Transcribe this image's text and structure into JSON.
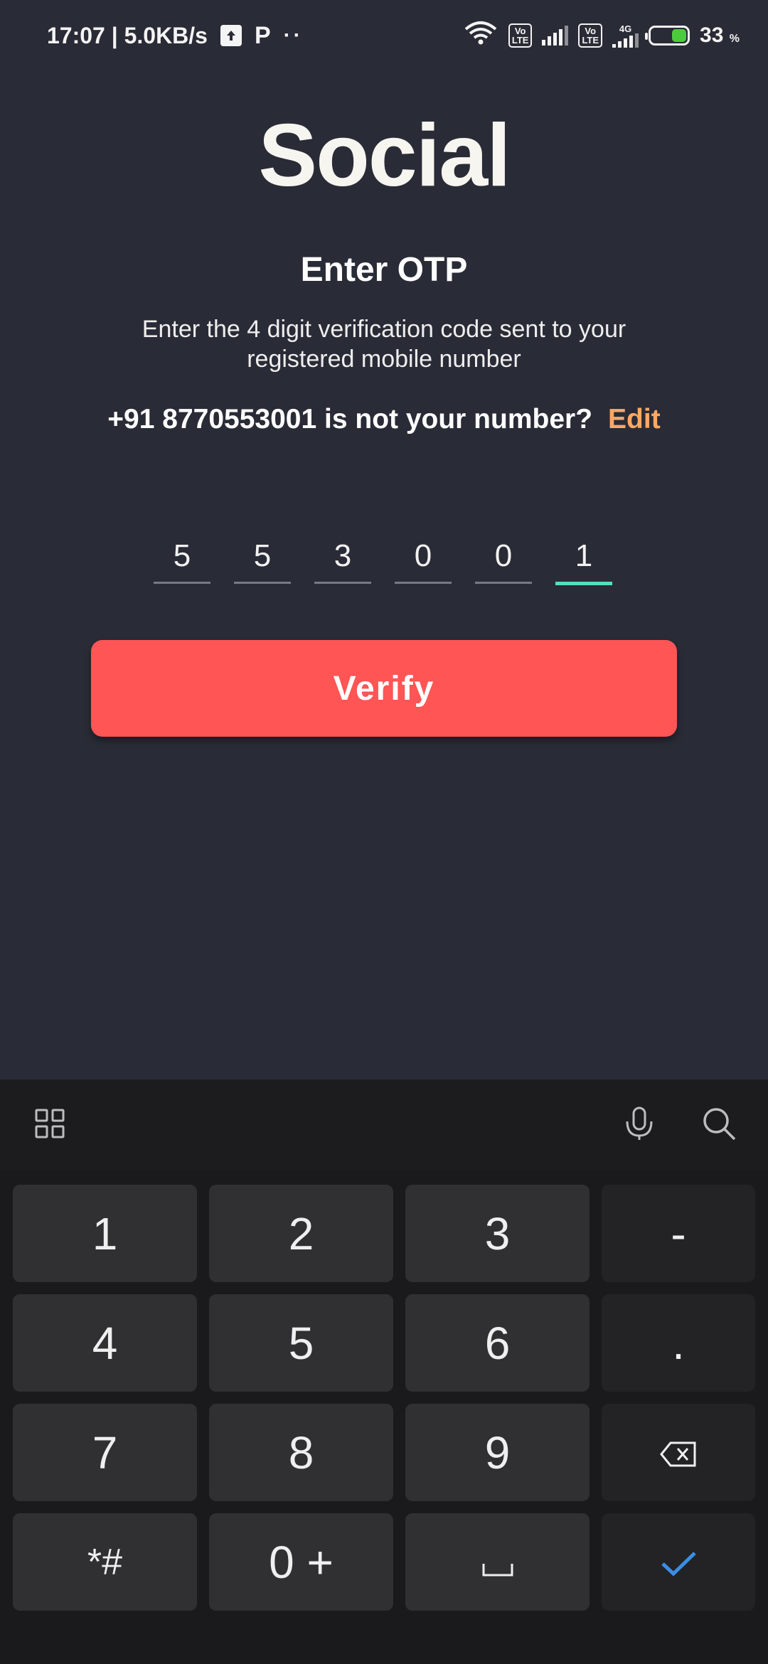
{
  "status_bar": {
    "time_speed": "17:07 | 5.0KB/s",
    "p_label": "P",
    "dots": "··",
    "volte": "Vo\nLTE",
    "network_4g": "4G",
    "battery_percent": "33",
    "percent_sign": "%"
  },
  "app": {
    "title": "Social",
    "heading": "Enter OTP",
    "description": "Enter the 4 digit verification code sent to your registered mobile number",
    "number_question": "+91 8770553001 is not your number?",
    "edit_label": "Edit",
    "otp_digits": [
      "5",
      "5",
      "3",
      "0",
      "0",
      "1"
    ],
    "verify_label": "Verify"
  },
  "keyboard": {
    "keys": [
      {
        "label": "1"
      },
      {
        "label": "2"
      },
      {
        "label": "3"
      },
      {
        "label": "-"
      },
      {
        "label": "4"
      },
      {
        "label": "5"
      },
      {
        "label": "6"
      },
      {
        "label": "."
      },
      {
        "label": "7"
      },
      {
        "label": "8"
      },
      {
        "label": "9"
      },
      {
        "label": "backspace-icon"
      },
      {
        "label": "*#"
      },
      {
        "label": "0 +"
      },
      {
        "label": "space-icon"
      },
      {
        "label": "check-icon"
      }
    ]
  },
  "colors": {
    "background": "#292b36",
    "accent_button": "#ff5555",
    "edit_link": "#ffa863",
    "active_underline": "#51e0c0"
  }
}
